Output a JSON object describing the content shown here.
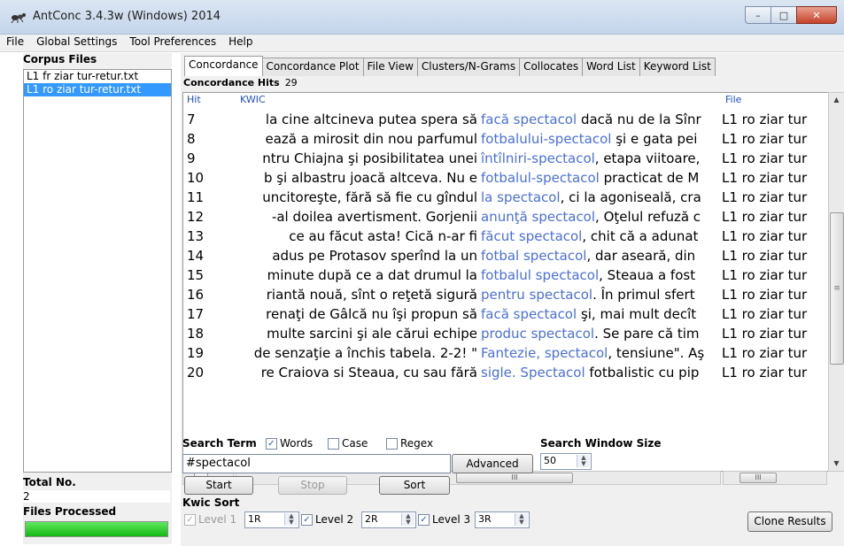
{
  "window": {
    "title": "AntConc 3.4.3w (Windows) 2014",
    "btn_min": "–",
    "btn_max": "□",
    "btn_close": "✕"
  },
  "menu": [
    "File",
    "Global Settings",
    "Tool Preferences",
    "Help"
  ],
  "left": {
    "corpus_files_label": "Corpus Files",
    "files": [
      "L1 fr ziar tur-retur.txt",
      "L1 ro ziar tur-retur.txt"
    ],
    "selected_index": 1,
    "total_no_label": "Total No.",
    "total_no_value": "2",
    "files_processed_label": "Files Processed",
    "progress_percent": 100
  },
  "tabs": [
    "Concordance",
    "Concordance Plot",
    "File View",
    "Clusters/N-Grams",
    "Collocates",
    "Word List",
    "Keyword List"
  ],
  "active_tab": 0,
  "concordance": {
    "hits_label": "Concordance Hits",
    "hits_value": "29",
    "col_hit": "Hit",
    "col_kwic": "KWIC",
    "col_file": "File",
    "rows": [
      {
        "hit": "7",
        "left": "la cine altcineva putea spera să",
        "kw": "facă spectacol",
        "right": " dacă nu de la Sînr",
        "file": "L1 ro ziar tur"
      },
      {
        "hit": "8",
        "left": "ează a mirosit din nou parfumul",
        "kw": "fotbalului-spectacol",
        "right": " şi e gata pei",
        "file": "L1 ro ziar tur"
      },
      {
        "hit": "9",
        "left": "ntru Chiajna şi posibilitatea unei",
        "kw": "întîlniri-spectacol",
        "right": ", etapa viitoare,",
        "file": "L1 ro ziar tur"
      },
      {
        "hit": "10",
        "left": "b şi albastru joacă altceva. Nu e",
        "kw": "fotbalul-spectacol",
        "right": " practicat de M",
        "file": "L1 ro ziar tur"
      },
      {
        "hit": "11",
        "left": "uncitoreşte, fără să fie cu gîndul",
        "kw": "la spectacol",
        "right": ", ci la agoniseală, cra",
        "file": "L1 ro ziar tur"
      },
      {
        "hit": "12",
        "left": "-al doilea avertisment.  Gorjenii",
        "kw": "anunţă spectacol",
        "right": ", Oţelul refuză c",
        "file": "L1 ro ziar tur"
      },
      {
        "hit": "13",
        "left": "ce au făcut asta! Cică n-ar fi",
        "kw": "făcut spectacol",
        "right": ", chit că a adunat",
        "file": "L1 ro ziar tur"
      },
      {
        "hit": "14",
        "left": "adus pe Protasov sperînd la un",
        "kw": "fotbal spectacol",
        "right": ", dar aseară, din",
        "file": "L1 ro ziar tur"
      },
      {
        "hit": "15",
        "left": "minute după ce a dat drumul la",
        "kw": "fotbalul spectacol",
        "right": ", Steaua a fost",
        "file": "L1 ro ziar tur"
      },
      {
        "hit": "16",
        "left": "riantă nouă, sînt o reţetă sigură",
        "kw": "pentru spectacol",
        "right": ". În primul sfert",
        "file": "L1 ro ziar tur"
      },
      {
        "hit": "17",
        "left": "renaţi de Gâlcă nu îşi propun să",
        "kw": "facă spectacol",
        "right": " şi, mai mult decît",
        "file": "L1 ro ziar tur"
      },
      {
        "hit": "18",
        "left": "multe sarcini şi ale cărui echipe",
        "kw": "produc spectacol",
        "right": ". Se pare că tim",
        "file": "L1 ro ziar tur"
      },
      {
        "hit": "19",
        "left": "de senzaţie a închis tabela. 2-2! \"",
        "kw": "Fantezie, spectacol",
        "right": ", tensiune\". Aş",
        "file": "L1 ro ziar tur"
      },
      {
        "hit": "20",
        "left": "re Craiova si Steaua, cu sau fără",
        "kw": "sigle. Spectacol",
        "right": " fotbalistic cu pip",
        "file": "L1 ro ziar tur"
      }
    ]
  },
  "search": {
    "term_label": "Search Term",
    "words_label": "Words",
    "words_checked": true,
    "case_label": "Case",
    "case_checked": false,
    "regex_label": "Regex",
    "regex_checked": false,
    "value": "#spectacol",
    "advanced_label": "Advanced",
    "window_size_label": "Search Window Size",
    "window_size_value": "50"
  },
  "buttons": {
    "start": "Start",
    "stop": "Stop",
    "sort": "Sort",
    "clone": "Clone Results"
  },
  "kwic_sort": {
    "label": "Kwic Sort",
    "level1_label": "Level 1",
    "level1_value": "1R",
    "level1_checked": true,
    "level2_label": "Level 2",
    "level2_value": "2R",
    "level2_checked": true,
    "level3_label": "Level 3",
    "level3_value": "3R",
    "level3_checked": true
  },
  "colors": {
    "keyword": "#4a6fd8",
    "selection": "#3399ff",
    "progress": "#15b815"
  }
}
